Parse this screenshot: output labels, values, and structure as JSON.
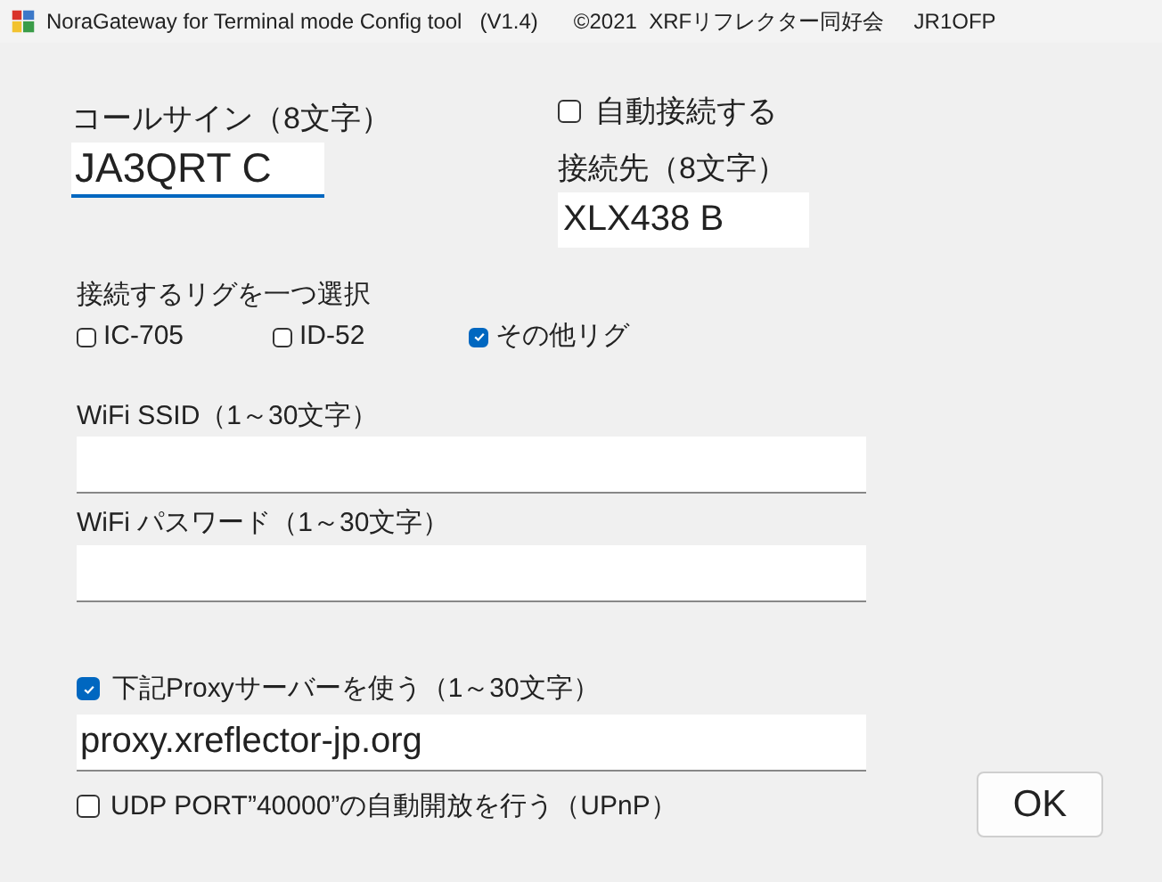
{
  "window": {
    "title": "NoraGateway for Terminal mode Config tool   (V1.4)      ©2021  XRFリフレクター同好会     JR1OFP"
  },
  "callsign": {
    "label": "コールサイン（8文字）",
    "value": "JA3QRT C"
  },
  "auto_connect": {
    "label": "自動接続する",
    "checked": false
  },
  "destination": {
    "label": "接続先（8文字）",
    "value": "XLX438 B"
  },
  "rig": {
    "label": "接続するリグを一つ選択",
    "options": [
      {
        "label": "IC-705",
        "checked": false
      },
      {
        "label": "ID-52",
        "checked": false
      },
      {
        "label": "その他リグ",
        "checked": true
      }
    ]
  },
  "wifi_ssid": {
    "label": "WiFi SSID（1～30文字）"
  },
  "wifi_password": {
    "label": "WiFi パスワード（1～30文字）"
  },
  "proxy": {
    "label": "下記Proxyサーバーを使う（1～30文字）",
    "checked": true,
    "value": "proxy.xreflector-jp.org"
  },
  "upnp": {
    "label": "UDP PORT”40000”の自動開放を行う（UPnP）",
    "checked": false
  },
  "ok_button": {
    "label": "OK"
  }
}
